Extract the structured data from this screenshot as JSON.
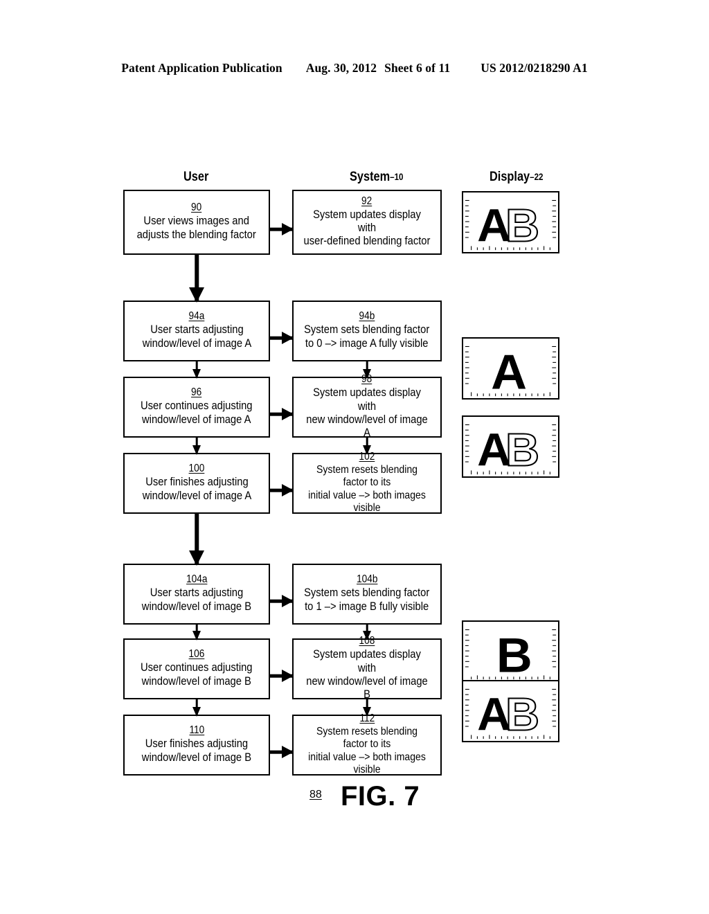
{
  "header": {
    "publication": "Patent Application Publication",
    "date": "Aug. 30, 2012",
    "sheet": "Sheet 6 of 11",
    "doc_number": "US 2012/0218290 A1"
  },
  "columns": {
    "user": {
      "title": "User",
      "ref": ""
    },
    "system": {
      "title": "System",
      "ref": "–10"
    },
    "display": {
      "title": "Display",
      "ref": "–22"
    }
  },
  "boxes": {
    "b90": {
      "num": "90",
      "text": "User views images and\nadjusts the blending factor"
    },
    "b92": {
      "num": "92",
      "text": "System updates display with\nuser-defined blending factor"
    },
    "b94a": {
      "num": "94a",
      "text": "User starts adjusting\nwindow/level of image A"
    },
    "b94b": {
      "num": "94b",
      "text": "System sets blending factor\nto 0 –> image A fully visible"
    },
    "b96": {
      "num": "96",
      "text": "User continues adjusting\nwindow/level of image A"
    },
    "b98": {
      "num": "98",
      "text": "System updates display with\nnew window/level of image A"
    },
    "b100": {
      "num": "100",
      "text": "User finishes adjusting\nwindow/level of image A"
    },
    "b102": {
      "num": "102",
      "text": "System resets blending factor to its\ninitial value –> both images visible"
    },
    "b104a": {
      "num": "104a",
      "text": "User starts adjusting\nwindow/level of image B"
    },
    "b104b": {
      "num": "104b",
      "text": "System sets blending factor\nto 1 –> image B fully visible"
    },
    "b106": {
      "num": "106",
      "text": "User continues adjusting\nwindow/level of image B"
    },
    "b108": {
      "num": "108",
      "text": "System updates display with\nnew window/level of image B"
    },
    "b110": {
      "num": "110",
      "text": "User finishes adjusting\nwindow/level of image B"
    },
    "b112": {
      "num": "112",
      "text": "System resets blending factor to its\ninitial value –> both images visible"
    }
  },
  "thumbnails": [
    {
      "id": "thumb-1",
      "content": "A-solid-and-B-outline"
    },
    {
      "id": "thumb-2",
      "content": "A-solid-only"
    },
    {
      "id": "thumb-3",
      "content": "A-solid-and-B-outline"
    },
    {
      "id": "thumb-4",
      "content": "B-solid-only"
    },
    {
      "id": "thumb-5",
      "content": "A-solid-and-B-outline"
    }
  ],
  "caption": {
    "ref": "88",
    "label": "FIG. 7"
  },
  "colors": {
    "ink": "#000000",
    "paper": "#ffffff"
  }
}
